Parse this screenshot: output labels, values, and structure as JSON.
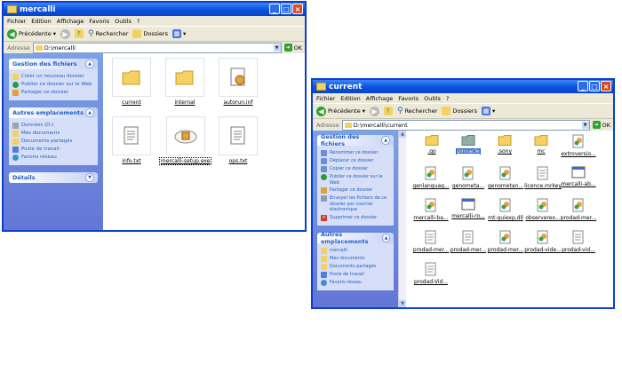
{
  "windows": [
    {
      "title": "mercalli",
      "menu": [
        "Fichier",
        "Edition",
        "Affichage",
        "Favoris",
        "Outils",
        "?"
      ],
      "toolbar": {
        "back": "Précédente",
        "search": "Rechercher",
        "folders": "Dossiers"
      },
      "address": {
        "label": "Adresse",
        "value": "D:\\mercalli",
        "go": "OK"
      },
      "panels": [
        {
          "title": "Gestion des fichiers",
          "items": [
            {
              "label": "Créer un nouveau dossier",
              "icon": "new-folder-icon"
            },
            {
              "label": "Publier ce dossier sur le Web",
              "icon": "globe-icon"
            },
            {
              "label": "Partager ce dossier",
              "icon": "share-icon"
            }
          ]
        },
        {
          "title": "Autres emplacements",
          "items": [
            {
              "label": "Données (D:)",
              "icon": "drive-icon"
            },
            {
              "label": "Mes documents",
              "icon": "folder-icon"
            },
            {
              "label": "Documents partagés",
              "icon": "folder-icon"
            },
            {
              "label": "Poste de travail",
              "icon": "computer-icon"
            },
            {
              "label": "Favoris réseau",
              "icon": "network-icon"
            }
          ]
        },
        {
          "title": "Détails",
          "items": []
        }
      ],
      "files": [
        {
          "name": "current",
          "type": "folder"
        },
        {
          "name": "internal",
          "type": "folder"
        },
        {
          "name": "autorun.inf",
          "type": "settings"
        },
        {
          "name": "info.txt",
          "type": "text"
        },
        {
          "name": "mercalli-setup.exe",
          "type": "setup"
        },
        {
          "name": "ops.txt",
          "type": "text"
        }
      ]
    },
    {
      "title": "current",
      "menu": [
        "Fichier",
        "Edition",
        "Affichage",
        "Favoris",
        "Outils",
        "?"
      ],
      "toolbar": {
        "back": "Précédente",
        "search": "Rechercher",
        "folders": "Dossiers"
      },
      "address": {
        "label": "Adresse",
        "value": "D:\\mercalli\\current",
        "go": "OK"
      },
      "panels": [
        {
          "title": "Gestion des fichiers",
          "items": [
            {
              "label": "Renommer ce dossier",
              "icon": "rename-icon"
            },
            {
              "label": "Déplacer ce dossier",
              "icon": "move-icon"
            },
            {
              "label": "Copier ce dossier",
              "icon": "copy-icon"
            },
            {
              "label": "Publier ce dossier sur le Web",
              "icon": "globe-icon"
            },
            {
              "label": "Partager ce dossier",
              "icon": "share-icon"
            },
            {
              "label": "Envoyer les fichiers de ce dossier par courrier électronique",
              "icon": "mail-icon"
            },
            {
              "label": "Supprimer ce dossier",
              "icon": "delete-icon"
            }
          ]
        },
        {
          "title": "Autres emplacements",
          "items": [
            {
              "label": "mercalli",
              "icon": "folder-icon"
            },
            {
              "label": "Mes documents",
              "icon": "folder-icon"
            },
            {
              "label": "Documents partagés",
              "icon": "folder-icon"
            },
            {
              "label": "Poste de travail",
              "icon": "computer-icon"
            },
            {
              "label": "Favoris réseau",
              "icon": "network-icon"
            }
          ]
        }
      ],
      "files": [
        {
          "name": ".qo",
          "type": "folder"
        },
        {
          "name": "pinnacle",
          "type": "folder-blue",
          "selected": true
        },
        {
          "name": ".sony",
          "type": "folder"
        },
        {
          "name": "mc",
          "type": "folder"
        },
        {
          "name": "extroversio...",
          "type": "dll"
        },
        {
          "name": "genlanguag...",
          "type": "dll"
        },
        {
          "name": "genometa...",
          "type": "dll"
        },
        {
          "name": "genometan...",
          "type": "dll"
        },
        {
          "name": "licence.mrkey",
          "type": "text"
        },
        {
          "name": "mercalli-ab...",
          "type": "window"
        },
        {
          "name": "mercalli-ba...",
          "type": "dll"
        },
        {
          "name": "mercalli-ro...",
          "type": "window"
        },
        {
          "name": "mt-guiexp.dll",
          "type": "dll"
        },
        {
          "name": "observerex...",
          "type": "dll"
        },
        {
          "name": "prodad-mer...",
          "type": "dll"
        },
        {
          "name": "prodad-mer...",
          "type": "text"
        },
        {
          "name": "prodad-mer...",
          "type": "text"
        },
        {
          "name": "prodad-mer...",
          "type": "dll"
        },
        {
          "name": "prodad-vide...",
          "type": "dll"
        },
        {
          "name": "prodad-vid...",
          "type": "text"
        },
        {
          "name": "prodad-Vid...",
          "type": "text"
        }
      ]
    }
  ],
  "colors": {
    "titlebar": "#0a52e0",
    "taskpane": "#6f8fe0",
    "link": "#215dc6",
    "folder": "#f4d261"
  }
}
